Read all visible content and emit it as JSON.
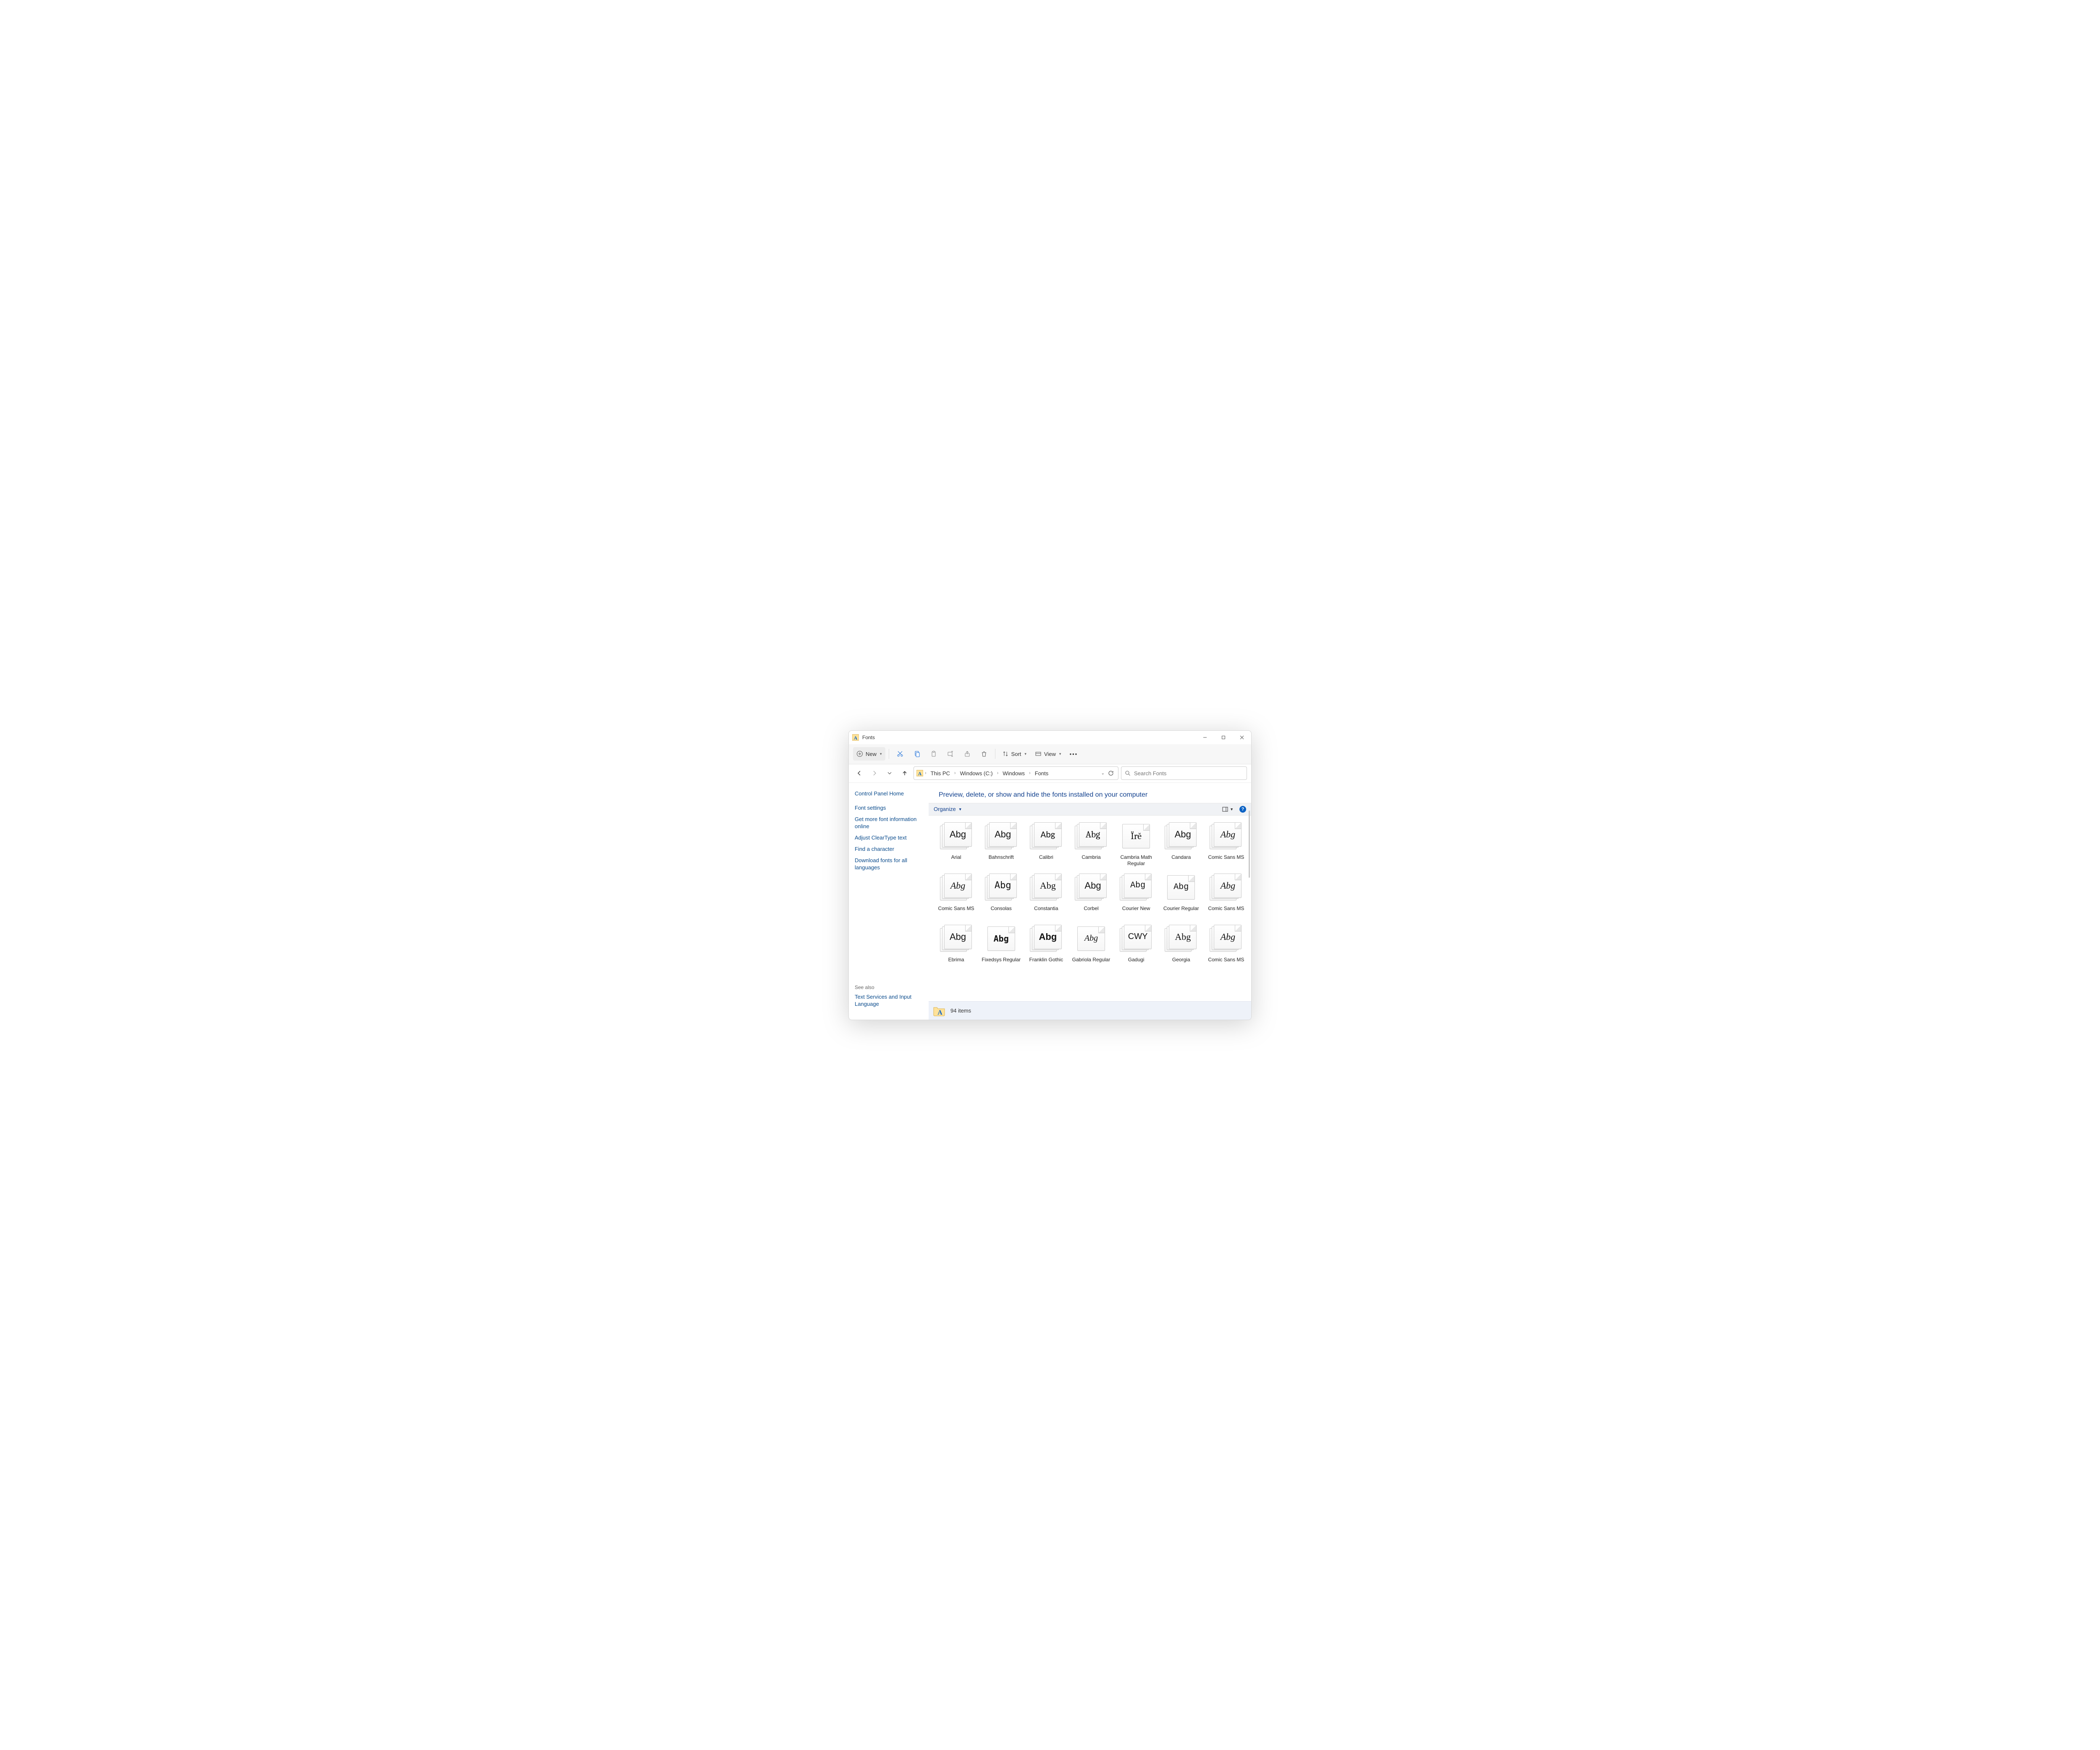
{
  "window": {
    "title": "Fonts"
  },
  "toolbar": {
    "new_label": "New",
    "sort_label": "Sort",
    "view_label": "View"
  },
  "breadcrumbs": [
    "This PC",
    "Windows (C:)",
    "Windows",
    "Fonts"
  ],
  "search": {
    "placeholder": "Search Fonts"
  },
  "sidebar": {
    "home": "Control Panel Home",
    "links": [
      "Font settings",
      "Get more font information online",
      "Adjust ClearType text",
      "Find a character",
      "Download fonts for all languages"
    ],
    "see_also_label": "See also",
    "see_also_links": [
      "Text Services and Input Language"
    ]
  },
  "main": {
    "heading": "Preview, delete, or show and hide the fonts installed on your computer",
    "organize_label": "Organize"
  },
  "fonts": [
    {
      "name": "Arial",
      "sample": "Abg",
      "style": "normal 22px Arial, sans-serif",
      "stack": true
    },
    {
      "name": "Bahnschrift",
      "sample": "Abg",
      "style": "normal 22px 'Segoe UI', sans-serif",
      "stack": true
    },
    {
      "name": "Calibri",
      "sample": "Abg",
      "style": "normal 22px Calibri, sans-serif",
      "stack": true
    },
    {
      "name": "Cambria",
      "sample": "Abg",
      "style": "normal 22px Cambria, Georgia, serif",
      "stack": true
    },
    {
      "name": "Cambria Math Regular",
      "sample": "Ïrĕ",
      "style": "normal 22px Cambria, Georgia, serif",
      "stack": false
    },
    {
      "name": "Candara",
      "sample": "Abg",
      "style": "normal 22px Candara, 'Segoe UI', sans-serif",
      "stack": true
    },
    {
      "name": "Comic Sans MS",
      "sample": "Abg",
      "style": "italic 22px 'Comic Sans MS', cursive",
      "stack": true
    },
    {
      "name": "Comic Sans MS",
      "sample": "Abg",
      "style": "italic 22px 'Comic Sans MS', cursive",
      "stack": true
    },
    {
      "name": "Consolas",
      "sample": "Abg",
      "style": "normal 22px Consolas, monospace",
      "stack": true
    },
    {
      "name": "Constantia",
      "sample": "Abg",
      "style": "normal 22px Constantia, Georgia, serif",
      "stack": true
    },
    {
      "name": "Corbel",
      "sample": "Abg",
      "style": "normal 22px Corbel, 'Segoe UI', sans-serif",
      "stack": true
    },
    {
      "name": "Courier New",
      "sample": "Abg",
      "style": "normal 20px 'Courier New', monospace",
      "stack": true
    },
    {
      "name": "Courier Regular",
      "sample": "Abg",
      "style": "normal 20px 'Courier New', monospace",
      "stack": false
    },
    {
      "name": "Comic Sans MS",
      "sample": "Abg",
      "style": "italic 22px 'Comic Sans MS', cursive",
      "stack": true
    },
    {
      "name": "Ebrima",
      "sample": "Abg",
      "style": "normal 22px 'Segoe UI', sans-serif",
      "stack": true
    },
    {
      "name": "Fixedsys Regular",
      "sample": "Abg",
      "style": "bold 20px Consolas, monospace",
      "stack": false
    },
    {
      "name": "Franklin Gothic",
      "sample": "Abg",
      "style": "bold 22px 'Franklin Gothic Medium', 'Arial Narrow', sans-serif",
      "stack": true
    },
    {
      "name": "Gabriola Regular",
      "sample": "Abg",
      "style": "italic 20px Georgia, serif",
      "stack": false
    },
    {
      "name": "Gadugi",
      "sample": "CWY",
      "style": "normal 20px 'Segoe UI', sans-serif",
      "stack": true
    },
    {
      "name": "Georgia",
      "sample": "Abg",
      "style": "normal 22px Georgia, serif",
      "stack": true
    },
    {
      "name": "Comic Sans MS",
      "sample": "Abg",
      "style": "italic 22px 'Comic Sans MS', cursive",
      "stack": true
    }
  ],
  "status": {
    "count_label": "94 items"
  }
}
